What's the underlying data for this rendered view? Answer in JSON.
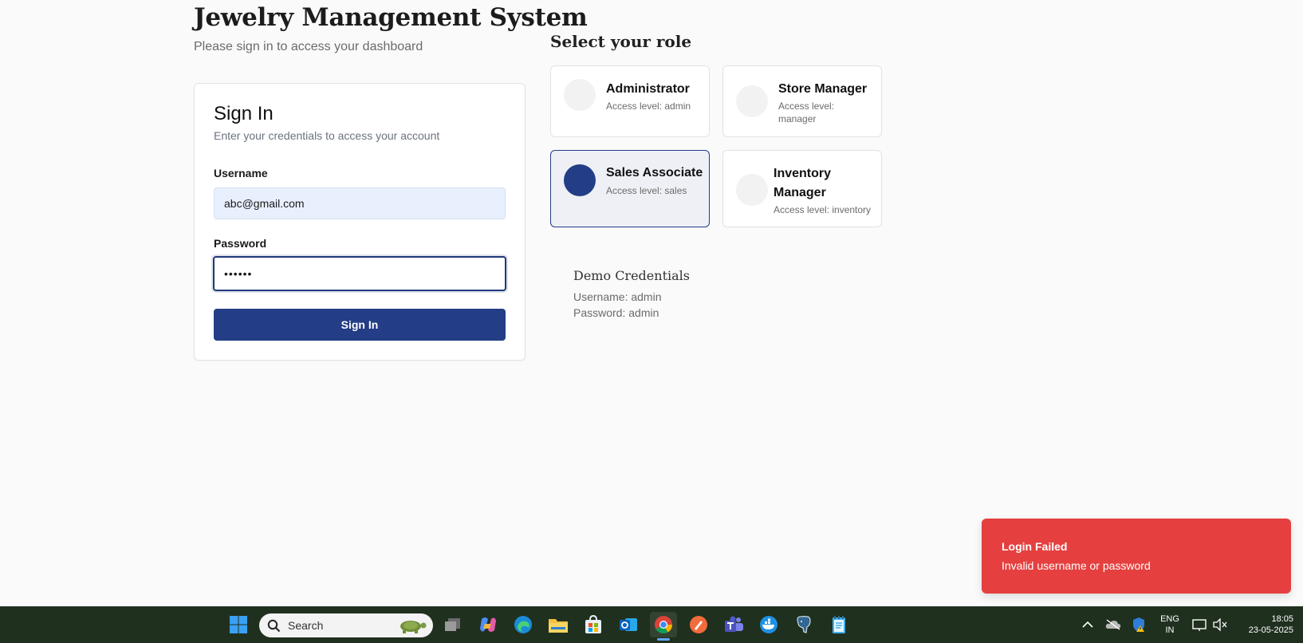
{
  "header": {
    "title": "Jewelry Management System",
    "subtitle": "Please sign in to access your dashboard"
  },
  "signin": {
    "title": "Sign In",
    "description": "Enter your credentials to access your account",
    "username_label": "Username",
    "username_value": "abc@gmail.com",
    "password_label": "Password",
    "password_value": "••••••",
    "button_label": "Sign In"
  },
  "roles": {
    "heading": "Select your role",
    "items": [
      {
        "name": "Administrator",
        "access": "Access level: admin",
        "selected": false
      },
      {
        "name": "Store Manager",
        "access": "Access level: manager",
        "selected": false
      },
      {
        "name": "Sales Associate",
        "access": "Access level: sales",
        "selected": true
      },
      {
        "name": "Inventory Manager",
        "access": "Access level: inventory",
        "selected": false
      }
    ]
  },
  "demo": {
    "title": "Demo Credentials",
    "username": "Username: admin",
    "password": "Password: admin"
  },
  "toast": {
    "title": "Login Failed",
    "message": "Invalid username or password"
  },
  "taskbar": {
    "search_label": "Search",
    "language": "ENG",
    "region": "IN",
    "time": "18:05",
    "date": "23-05-2025"
  },
  "colors": {
    "primary": "#233d86",
    "toast_error": "#e5403f",
    "taskbar": "#20301f"
  }
}
